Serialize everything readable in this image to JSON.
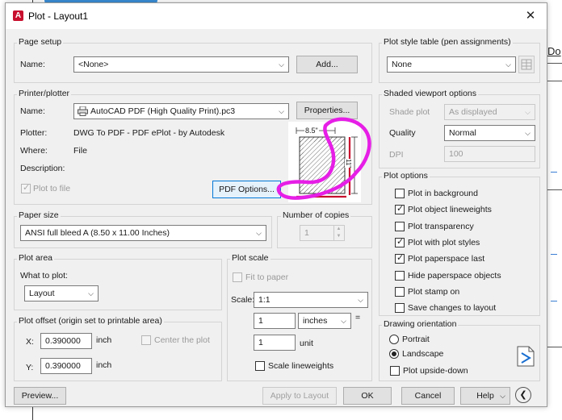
{
  "background": {
    "right_text": "Do"
  },
  "dialog": {
    "title": "Plot - Layout1",
    "app_icon_glyph": "A",
    "close_glyph": "✕"
  },
  "page_setup": {
    "group_title": "Page setup",
    "name_label": "Name:",
    "name_value": "<None>",
    "add_button": "Add..."
  },
  "printer": {
    "group_title": "Printer/plotter",
    "name_label": "Name:",
    "name_value": "AutoCAD PDF (High Quality Print).pc3",
    "properties_button": "Properties...",
    "plotter_label": "Plotter:",
    "plotter_value": "DWG To PDF - PDF ePlot - by Autodesk",
    "where_label": "Where:",
    "where_value": "File",
    "description_label": "Description:",
    "plot_to_file_label": "Plot to file",
    "plot_to_file_checked": true,
    "pdf_options_button": "PDF Options...",
    "preview_width_label": "8.5\"",
    "preview_height_label": "11\""
  },
  "paper_size": {
    "group_title": "Paper size",
    "value": "ANSI full bleed A (8.50 x 11.00 Inches)"
  },
  "copies": {
    "label": "Number of copies",
    "value": "1"
  },
  "plot_area": {
    "group_title": "Plot area",
    "what_label": "What to plot:",
    "what_value": "Layout"
  },
  "plot_scale": {
    "group_title": "Plot scale",
    "fit_label": "Fit to paper",
    "scale_label": "Scale:",
    "scale_value": "1:1",
    "value1": "1",
    "units": "inches",
    "equals": "=",
    "value2": "1",
    "unit_label": "unit",
    "lineweights_label": "Scale lineweights"
  },
  "plot_offset": {
    "group_title": "Plot offset (origin set to printable area)",
    "x_label": "X:",
    "x_value": "0.390000",
    "x_unit": "inch",
    "center_label": "Center the plot",
    "y_label": "Y:",
    "y_value": "0.390000",
    "y_unit": "inch"
  },
  "plot_style": {
    "group_title": "Plot style table (pen assignments)",
    "value": "None"
  },
  "shaded": {
    "group_title": "Shaded viewport options",
    "shade_label": "Shade plot",
    "shade_value": "As displayed",
    "quality_label": "Quality",
    "quality_value": "Normal",
    "dpi_label": "DPI",
    "dpi_value": "100"
  },
  "plot_options": {
    "group_title": "Plot options",
    "items": [
      {
        "label": "Plot in background",
        "checked": false
      },
      {
        "label": "Plot object lineweights",
        "checked": true
      },
      {
        "label": "Plot transparency",
        "checked": false
      },
      {
        "label": "Plot with plot styles",
        "checked": true
      },
      {
        "label": "Plot paperspace last",
        "checked": true
      },
      {
        "label": "Hide paperspace objects",
        "checked": false
      },
      {
        "label": "Plot stamp on",
        "checked": false
      },
      {
        "label": "Save changes to layout",
        "checked": false
      }
    ]
  },
  "orientation": {
    "group_title": "Drawing orientation",
    "portrait_label": "Portrait",
    "landscape_label": "Landscape",
    "selected": "Landscape",
    "upside_down_label": "Plot upside-down"
  },
  "footer": {
    "preview_button": "Preview...",
    "apply_button": "Apply to Layout",
    "ok_button": "OK",
    "cancel_button": "Cancel",
    "help_button": "Help",
    "collapse_glyph": "❮"
  },
  "colors": {
    "annotation": "#e61ee6",
    "accent_focus": "#0078d7",
    "preview_red": "#c8102e"
  }
}
